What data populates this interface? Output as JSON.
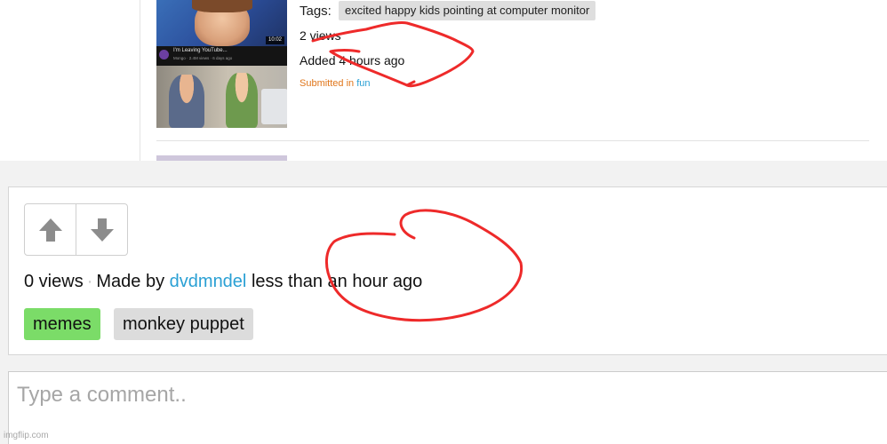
{
  "top_screenshot": {
    "thumbnail": {
      "badge": "10:02",
      "title": "I'm Leaving YouTube...",
      "meta": "Mongo · 2.4M views · 6 days ago"
    },
    "tags_label": "Tags:",
    "tag": "excited happy kids pointing at computer monitor",
    "views": "2 views",
    "added": "Added 4 hours ago",
    "submitted_prefix": "Submitted in",
    "submitted_category": "fun"
  },
  "meme": {
    "icons": {
      "upvote": "arrow-up-icon",
      "downvote": "arrow-down-icon"
    },
    "views": "0 views",
    "separator": "·",
    "made_by": "Made by",
    "username": "dvdmndel",
    "time": "less than an hour ago",
    "tags": [
      "memes",
      "monkey puppet"
    ]
  },
  "comment": {
    "placeholder": "Type a comment.."
  },
  "watermark": "imgflip.com",
  "colors": {
    "link": "#2aa0d4",
    "submitted": "#e0761b",
    "tag_memes": "#7bdc68",
    "tag_default": "#dcdcdc",
    "scribble": "#ee2a2a"
  }
}
